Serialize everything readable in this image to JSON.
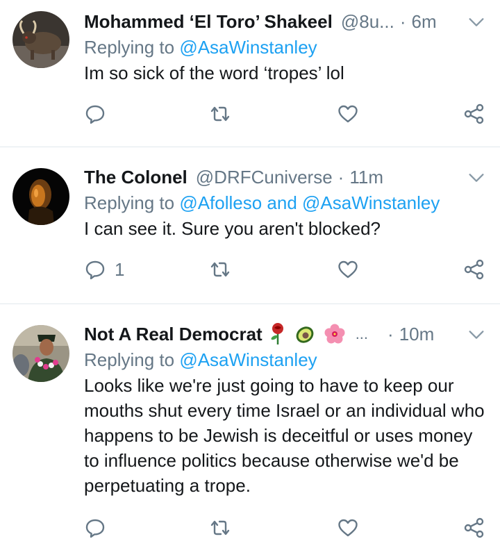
{
  "tweets": [
    {
      "name": "Mohammed ‘El Toro’ Shakeel",
      "handle": "@8u...",
      "dot": "·",
      "time": "6m",
      "replying_prefix": "Replying to ",
      "replying_to": "@AsaWinstanley",
      "text": "Im so sick of the word ‘tropes’ lol",
      "reply_count": ""
    },
    {
      "name": "The Colonel",
      "handle": "@DRFCuniverse",
      "dot": "·",
      "time": "11m",
      "replying_prefix": "Replying to ",
      "replying_to": "@Afolleso and @AsaWinstanley",
      "text": "I can see it. Sure you aren't blocked?",
      "reply_count": "1"
    },
    {
      "name": "Not A Real Democrat",
      "handle": "...",
      "dot": "·",
      "time": "10m",
      "replying_prefix": "Replying to ",
      "replying_to": "@AsaWinstanley",
      "text": "Looks like we're just going to have to keep our mouths shut every time Israel or an individual who happens to be Jewish is deceitful or uses money to influence politics because otherwise we'd be perpetuating a trope.",
      "reply_count": ""
    }
  ],
  "icons": [
    "reply-icon",
    "retweet-icon",
    "like-icon",
    "share-icon",
    "chevron-down-icon"
  ],
  "colors": {
    "link": "#1da1f2",
    "muted": "#657786",
    "text": "#14171a",
    "divider": "#e1e8ed"
  }
}
